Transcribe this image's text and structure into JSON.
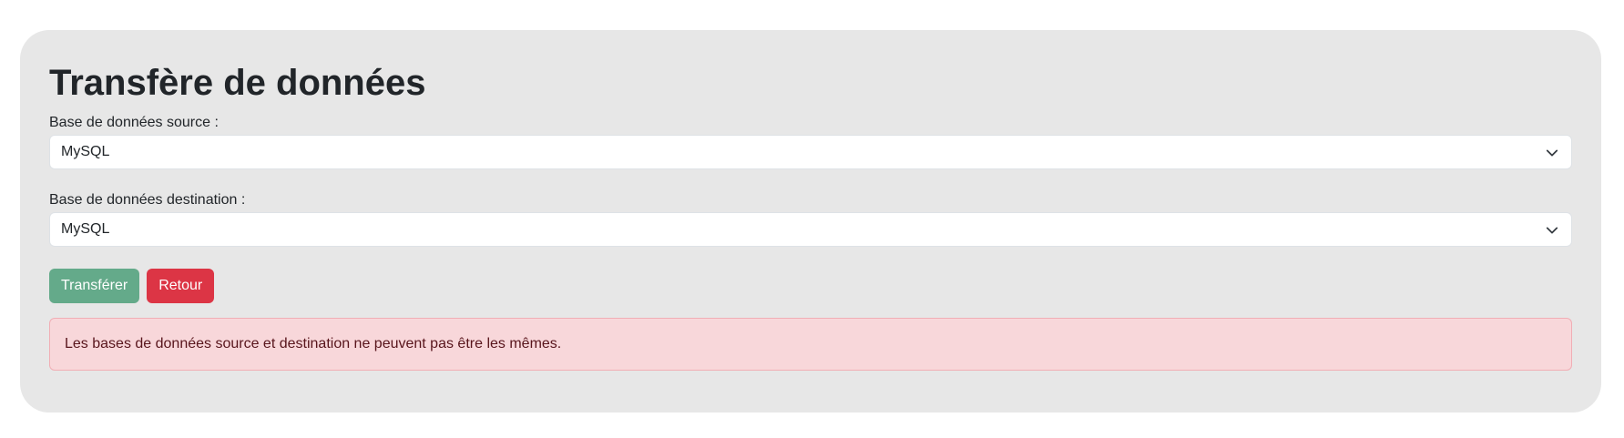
{
  "page": {
    "title": "Transfère de données"
  },
  "form": {
    "source": {
      "label": "Base de données source :",
      "selected": "MySQL"
    },
    "destination": {
      "label": "Base de données destination :",
      "selected": "MySQL"
    }
  },
  "actions": {
    "transfer_label": "Transférer",
    "back_label": "Retour"
  },
  "alert": {
    "message": "Les bases de données source et destination ne peuvent pas être les mêmes."
  },
  "colors": {
    "card_background": "#e7e7e7",
    "success": "#64aa8a",
    "danger": "#dc3545",
    "alert_background": "#f8d7da",
    "alert_text": "#58151c"
  },
  "icons": {
    "select_arrow": "chevron-down-icon"
  }
}
